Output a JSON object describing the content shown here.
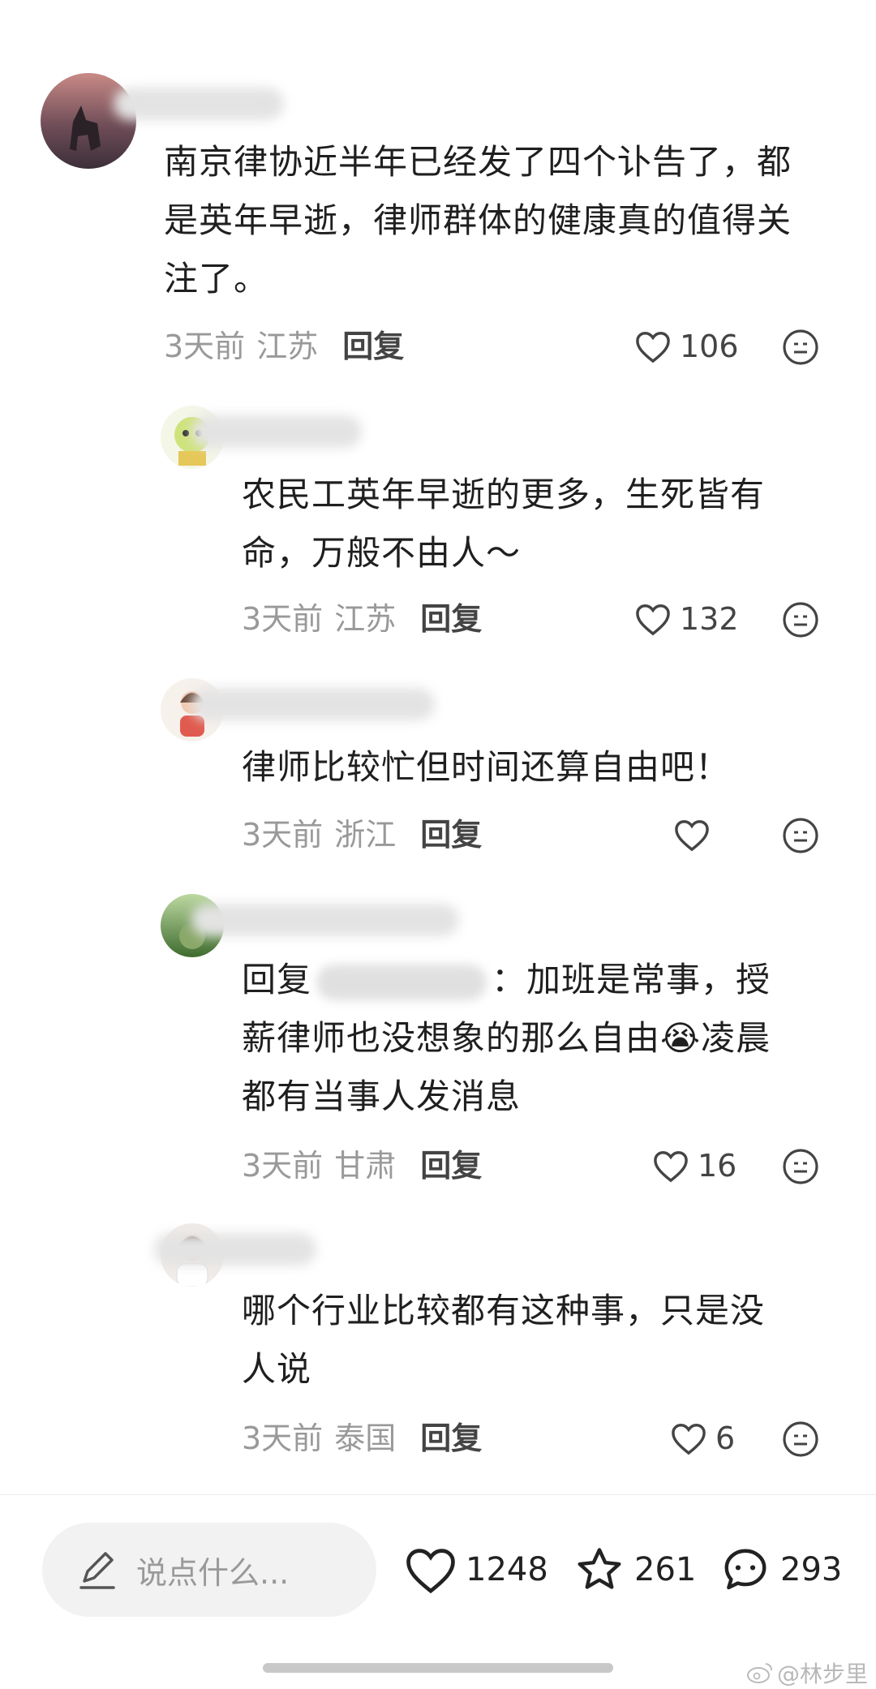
{
  "comments": [
    {
      "lines": [
        "南京律协近半年已经发了四个讣告了，都",
        "是英年早逝，律师群体的健康真的值得关",
        "注了。"
      ],
      "time": "3天前",
      "location": "江苏",
      "reply": "回复",
      "likes": "106"
    },
    {
      "lines": [
        "农民工英年早逝的更多，生死皆有",
        "命，万般不由人～"
      ],
      "time": "3天前",
      "location": "江苏",
      "reply": "回复",
      "likes": "132"
    },
    {
      "lines": [
        "律师比较忙但时间还算自由吧！"
      ],
      "time": "3天前",
      "location": "浙江",
      "reply": "回复",
      "likes": ""
    },
    {
      "reply_prefix": "回复",
      "reply_suffix": "：加班是常事，授",
      "lines": [
        "薪律师也没想象的那么自由😭凌晨",
        "都有当事人发消息"
      ],
      "time": "3天前",
      "location": "甘肃",
      "reply": "回复",
      "likes": "16"
    },
    {
      "lines": [
        "哪个行业比较都有这种事，只是没",
        "人说"
      ],
      "time": "3天前",
      "location": "泰国",
      "reply": "回复",
      "likes": "6"
    }
  ],
  "bottom_bar": {
    "input_placeholder": "说点什么...",
    "likes": "1248",
    "favorites": "261",
    "comments": "293"
  },
  "watermark": "@林步里",
  "colors": {
    "muted": "#999999",
    "accent": "#444444",
    "background": "#ffffff"
  }
}
